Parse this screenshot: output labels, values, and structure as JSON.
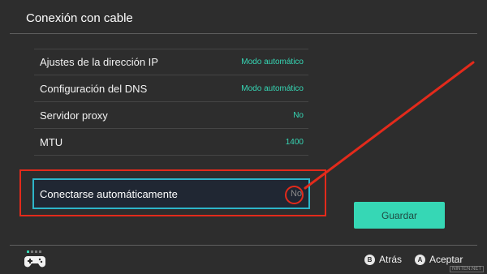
{
  "header": {
    "title": "Conexión con cable"
  },
  "settings": [
    {
      "label": "Ajustes de la dirección IP",
      "value": "Modo automático"
    },
    {
      "label": "Configuración del DNS",
      "value": "Modo automático"
    },
    {
      "label": "Servidor proxy",
      "value": "No"
    },
    {
      "label": "MTU",
      "value": "1400"
    }
  ],
  "selected_setting": {
    "label": "Conectarse automáticamente",
    "value": "No"
  },
  "actions": {
    "save_label": "Guardar"
  },
  "footer": {
    "back": {
      "glyph": "B",
      "label": "Atrás"
    },
    "accept": {
      "glyph": "A",
      "label": "Aceptar"
    }
  },
  "watermark": "NINTEN.NET",
  "colors": {
    "accent": "#36d7b5",
    "selection": "#2db5c9",
    "annotation": "#e32a1b",
    "background": "#2d2d2d"
  },
  "icons": {
    "controller": "joycon-controller-icon"
  }
}
